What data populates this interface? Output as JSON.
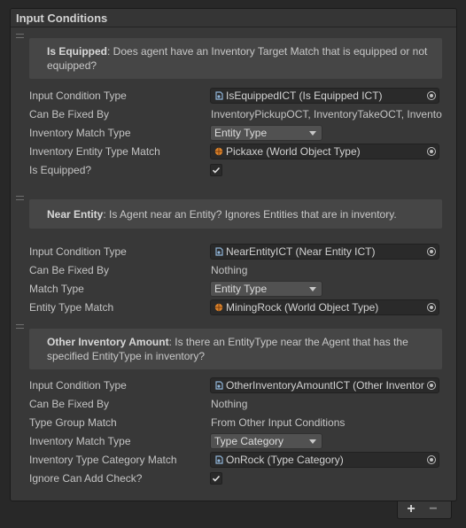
{
  "list": {
    "title": "Input Conditions",
    "add_label": "+",
    "remove_label": "−",
    "elements": [
      {
        "help_name": "Is Equipped",
        "help_text": ": Does agent have an Inventory Target Match that is equipped or not equipped?",
        "fields": [
          {
            "label": "Input Condition Type",
            "kind": "object",
            "value": "IsEquippedICT (Is Equipped ICT)",
            "icon": "script-icon"
          },
          {
            "label": "Can Be Fixed By",
            "kind": "text",
            "value": "InventoryPickupOCT, InventoryTakeOCT, InventoryTakeOCT"
          },
          {
            "label": "Inventory Match Type",
            "kind": "dropdown",
            "value": "Entity Type"
          },
          {
            "label": "Inventory Entity Type Match",
            "kind": "object",
            "value": "Pickaxe (World Object Type)",
            "icon": "entity-type-icon"
          },
          {
            "label": "Is Equipped?",
            "kind": "checkbox",
            "value": "checked"
          }
        ]
      },
      {
        "help_name": "Near Entity",
        "help_text": ": Is Agent near an Entity?  Ignores Entities that are in inventory.",
        "fields": [
          {
            "label": "Input Condition Type",
            "kind": "object",
            "value": "NearEntityICT (Near Entity ICT)",
            "icon": "script-icon"
          },
          {
            "label": "Can Be Fixed By",
            "kind": "text",
            "value": "Nothing"
          },
          {
            "label": "Match Type",
            "kind": "dropdown",
            "value": "Entity Type"
          },
          {
            "label": "Entity Type Match",
            "kind": "object",
            "value": "MiningRock (World Object Type)",
            "icon": "entity-type-icon"
          }
        ]
      },
      {
        "help_name": "Other Inventory Amount",
        "help_text": ": Is there an EntityType near the Agent that has the specified EntityType in inventory?",
        "fields": [
          {
            "label": "Input Condition Type",
            "kind": "object",
            "value": "OtherInventoryAmountICT (Other Inventory Amount ICT)",
            "icon": "script-icon"
          },
          {
            "label": "Can Be Fixed By",
            "kind": "text",
            "value": "Nothing"
          },
          {
            "label": "Type Group Match",
            "kind": "text",
            "value": "From Other Input Conditions"
          },
          {
            "label": "Inventory Match Type",
            "kind": "dropdown",
            "value": "Type Category"
          },
          {
            "label": "Inventory Type Category Match",
            "kind": "object",
            "value": "OnRock (Type Category)",
            "icon": "script-icon"
          },
          {
            "label": "Ignore Can Add Check?",
            "kind": "checkbox",
            "value": "checked"
          }
        ]
      }
    ]
  }
}
